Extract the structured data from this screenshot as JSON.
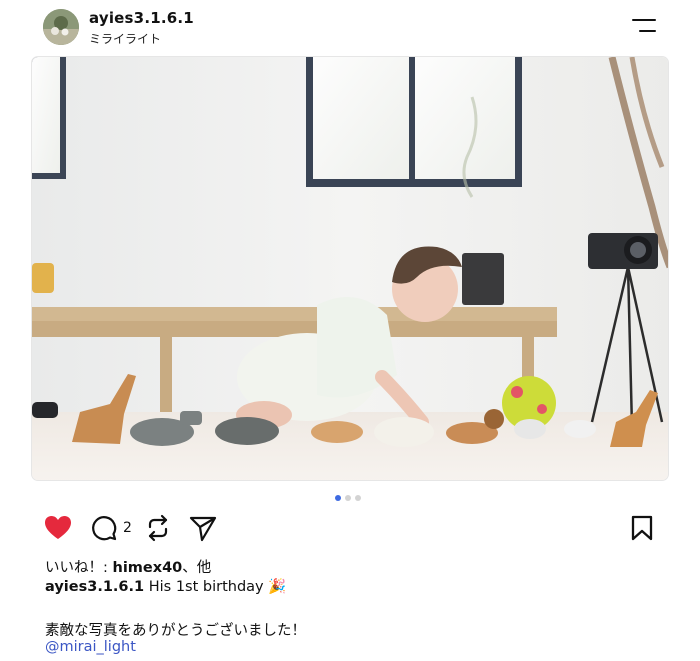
{
  "post": {
    "username": "ayies3.1.6.1",
    "location": "ミライライト",
    "photo_alt": "Baby crawling among toy animal figures",
    "carousel": {
      "total": 3,
      "active": 1
    }
  },
  "actions": {
    "liked": true,
    "comment_count": "2"
  },
  "likes_line": {
    "prefix": "いいね！: ",
    "user": "himex40",
    "suffix": "、他"
  },
  "caption": {
    "user": "ayies3.1.6.1",
    "text": " His 1st birthday 🎉"
  },
  "comment": {
    "text": "素敵な写真をありがとうございました！",
    "mention": "@mirai_light"
  },
  "colors": {
    "like": "#e5293d",
    "accent": "#3e6ae1",
    "mention": "#3b56c4"
  },
  "icons": [
    "avatar",
    "menu-icon",
    "heart-icon",
    "comment-icon",
    "repost-icon",
    "send-icon",
    "bookmark-icon"
  ]
}
